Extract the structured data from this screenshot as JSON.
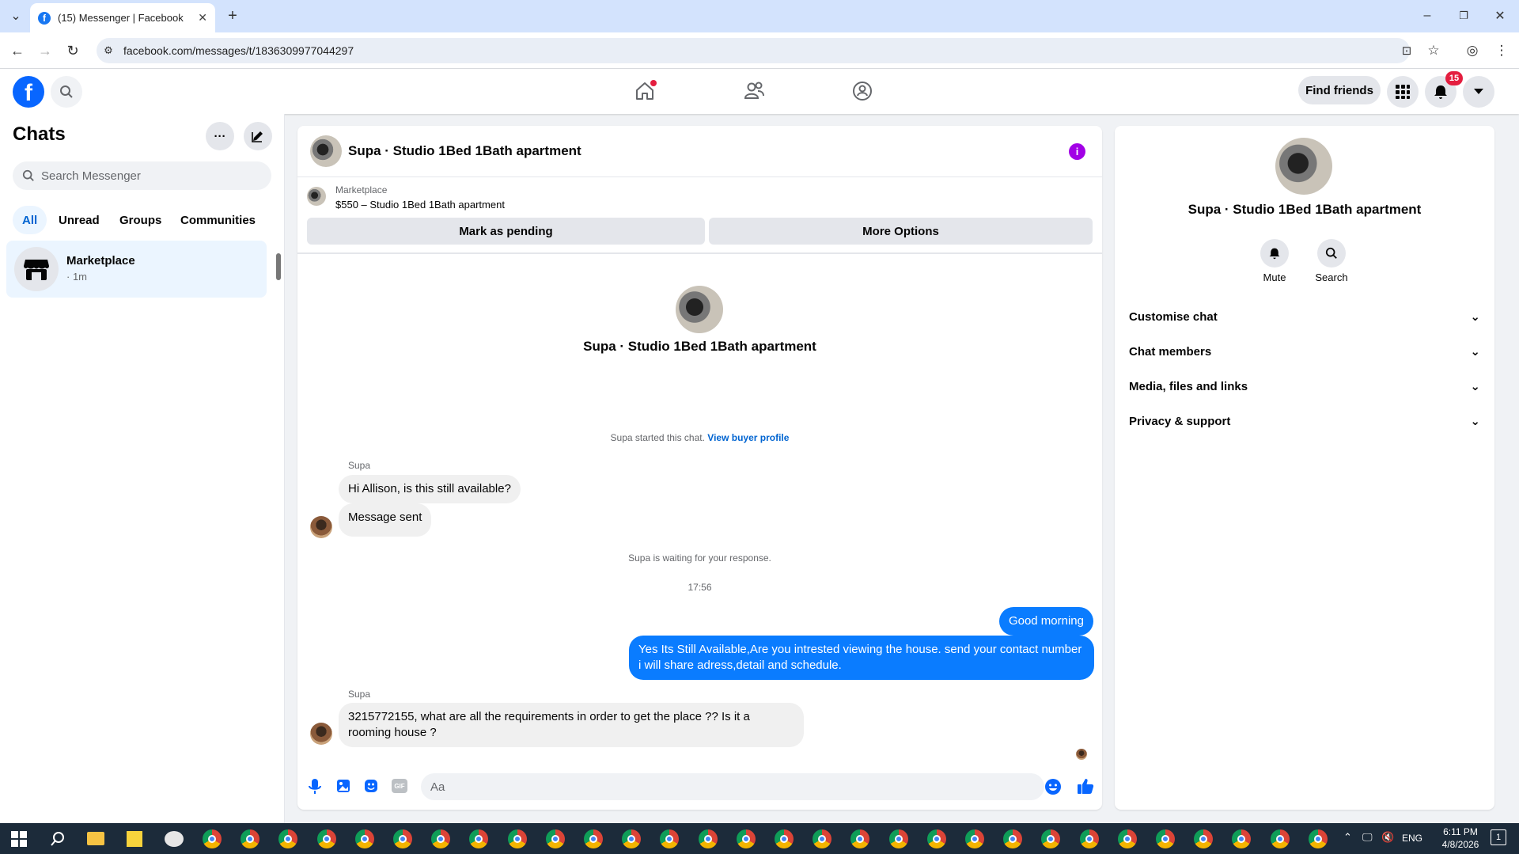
{
  "browser": {
    "tab_title": "(15) Messenger | Facebook",
    "url": "facebook.com/messages/t/1836309977044297"
  },
  "header": {
    "find_friends": "Find friends",
    "notification_count": "15"
  },
  "sidebar": {
    "title": "Chats",
    "search_placeholder": "Search Messenger",
    "filters": [
      "All",
      "Unread",
      "Groups",
      "Communities"
    ],
    "chat": {
      "name": "Marketplace",
      "meta": "· 1m"
    }
  },
  "conversation": {
    "title": "Supa · Studio 1Bed 1Bath apartment",
    "listing_label": "Marketplace",
    "listing_detail": "$550 – Studio 1Bed 1Bath apartment",
    "mark_pending": "Mark as pending",
    "more_options": "More Options",
    "profile_name": "Supa · Studio 1Bed 1Bath apartment",
    "started_text": "Supa started this chat.",
    "view_profile": "View buyer profile",
    "sender1": "Supa",
    "msg1": "Hi Allison, is this still available?",
    "msg2": "Message sent",
    "waiting": "Supa is waiting for your response.",
    "time": "17:56",
    "out1": "Good morning",
    "out2": "Yes Its Still Available,Are you intrested viewing the house. send your contact number i will share adress,detail and schedule.",
    "sender2": "Supa",
    "msg3": "3215772155, what are all the requirements in order to get the place ?? Is it a rooming house ?",
    "composer_placeholder": "Aa"
  },
  "right_panel": {
    "name": "Supa · Studio 1Bed 1Bath apartment",
    "mute": "Mute",
    "search": "Search",
    "sections": [
      "Customise chat",
      "Chat members",
      "Media, files and links",
      "Privacy & support"
    ]
  },
  "taskbar": {
    "lang": "ENG",
    "time": "6:11 PM",
    "date": "4/8/2026",
    "notifications": "1"
  },
  "colors": {
    "brand": "#0866ff",
    "outgoing_bubble": "#0a7cff",
    "badge": "#e41e3f"
  }
}
